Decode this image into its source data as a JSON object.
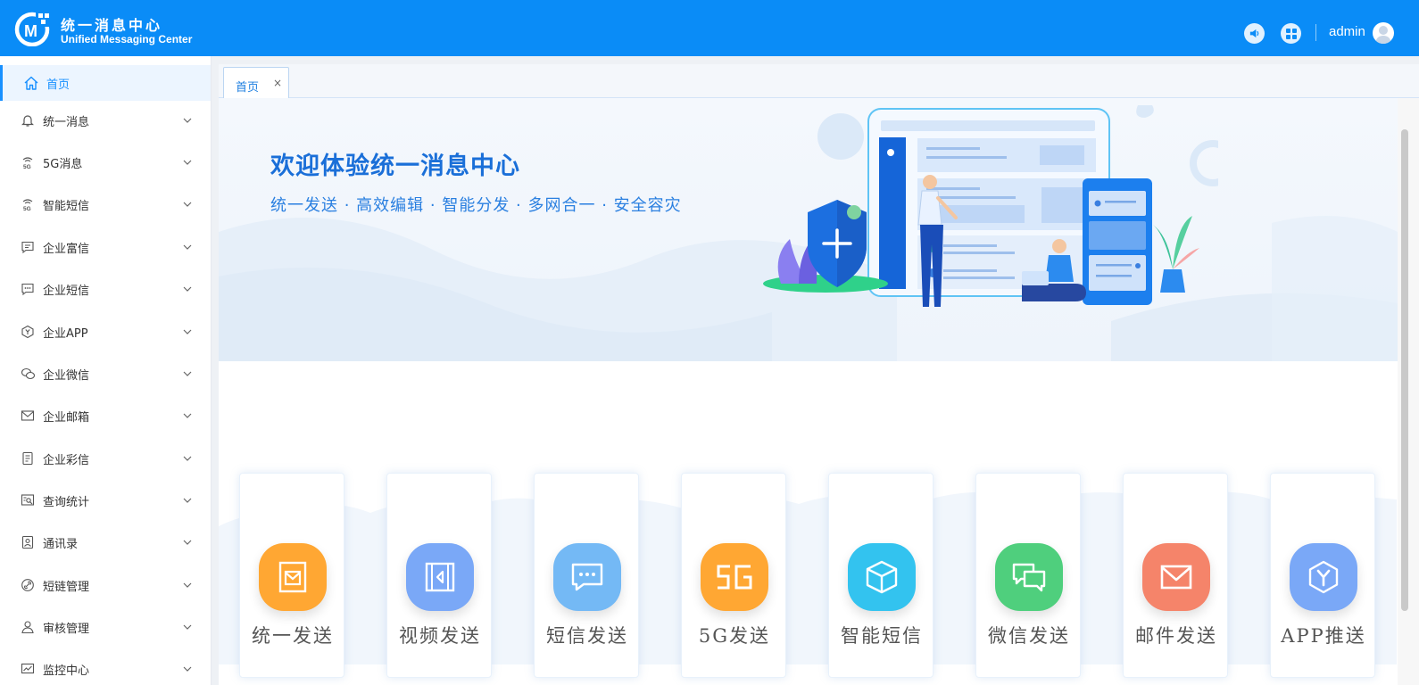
{
  "header": {
    "brand_cn": "统一消息中心",
    "brand_en": "Unified Messaging Center",
    "username": "admin",
    "bg_color": "#0a8cf7",
    "icons": [
      "volume-icon",
      "apps-grid-icon",
      "user-avatar-icon"
    ]
  },
  "sidebar": {
    "items": [
      {
        "label": "首页",
        "icon": "home-icon",
        "active": true
      },
      {
        "label": "统一消息",
        "icon": "bell-icon"
      },
      {
        "label": "5G消息",
        "icon": "5g-signal-icon"
      },
      {
        "label": "智能短信",
        "icon": "5g-signal-icon"
      },
      {
        "label": "企业富信",
        "icon": "message-square-icon"
      },
      {
        "label": "企业短信",
        "icon": "chat-dots-icon"
      },
      {
        "label": "企业APP",
        "icon": "hexagon-y-icon"
      },
      {
        "label": "企业微信",
        "icon": "wechat-icon"
      },
      {
        "label": "企业邮箱",
        "icon": "mail-icon"
      },
      {
        "label": "企业彩信",
        "icon": "document-icon"
      },
      {
        "label": "查询统计",
        "icon": "search-stats-icon"
      },
      {
        "label": "通讯录",
        "icon": "contacts-icon"
      },
      {
        "label": "短链管理",
        "icon": "link-icon"
      },
      {
        "label": "审核管理",
        "icon": "user-review-icon"
      },
      {
        "label": "监控中心",
        "icon": "monitor-chart-icon"
      }
    ]
  },
  "tabs": [
    {
      "label": "首页",
      "close": "×"
    }
  ],
  "banner": {
    "title": "欢迎体验统一消息中心",
    "subtitle": "统一发送 · 高效编辑 · 智能分发 · 多网合一 · 安全容灾"
  },
  "tiles": [
    {
      "label": "统一发送",
      "icon": "envelope-card-icon",
      "color": "#ffa733"
    },
    {
      "label": "视频发送",
      "icon": "video-play-icon",
      "color": "#7aa8f7"
    },
    {
      "label": "短信发送",
      "icon": "chat-bubble-icon",
      "color": "#74b9f5"
    },
    {
      "label": "5G发送",
      "icon": "5g-text-icon",
      "color": "#ffa733"
    },
    {
      "label": "智能短信",
      "icon": "cube-icon",
      "color": "#33c3ef"
    },
    {
      "label": "微信发送",
      "icon": "double-chat-icon",
      "color": "#4fcf7d"
    },
    {
      "label": "邮件发送",
      "icon": "mail-icon",
      "color": "#f5846a"
    },
    {
      "label": "APP推送",
      "icon": "hexagon-y-icon",
      "color": "#7aa8f7"
    }
  ]
}
